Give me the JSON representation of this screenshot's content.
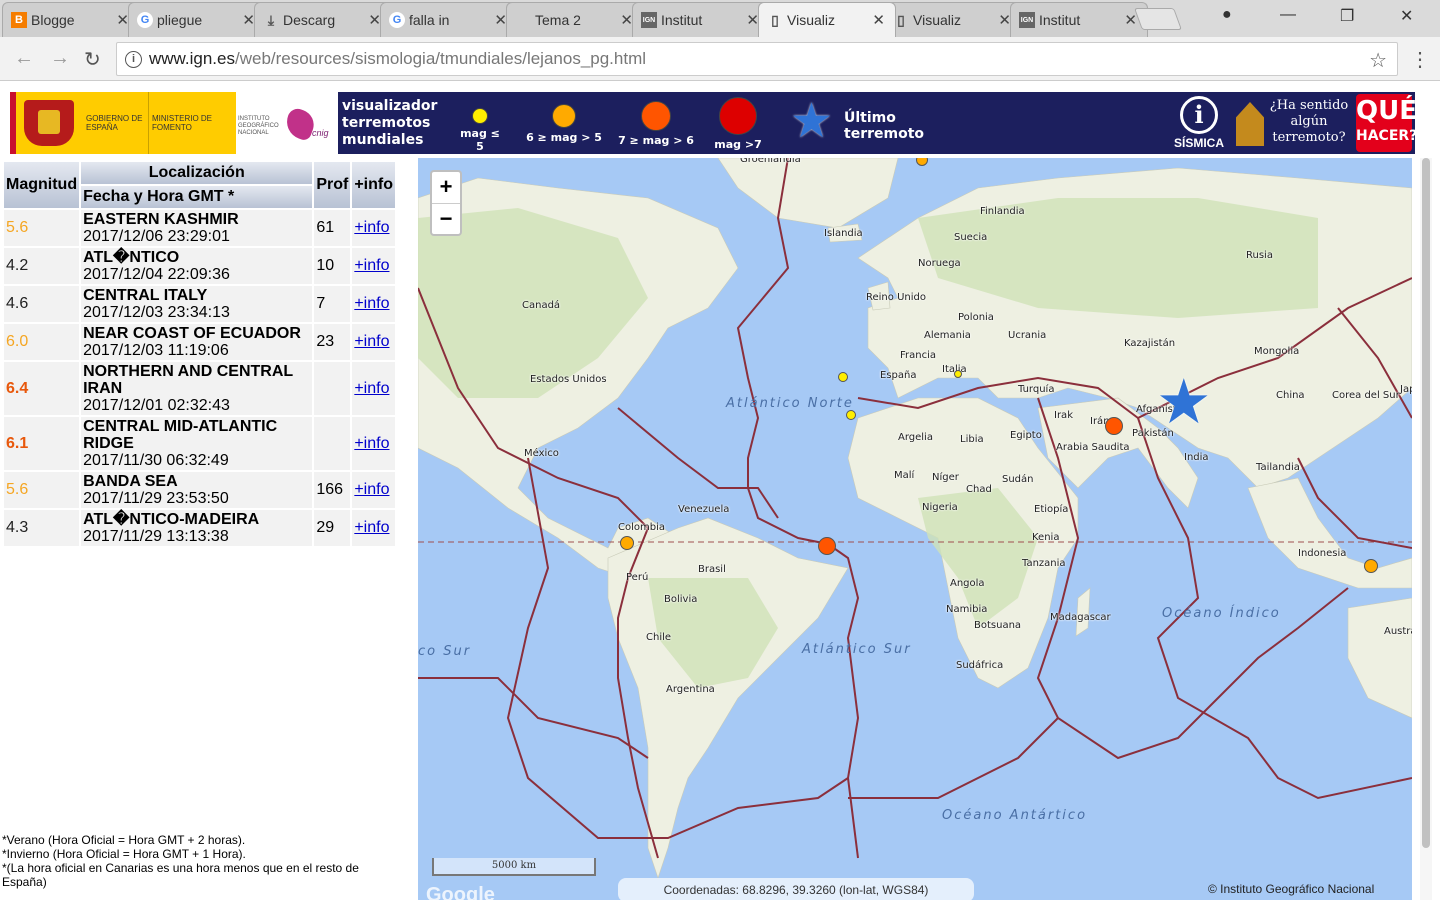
{
  "browser": {
    "tabs": [
      {
        "label": "Blogge",
        "icon": "blogger-icon",
        "color": "#f57d00",
        "glyph": "B"
      },
      {
        "label": "pliegue",
        "icon": "google-icon",
        "color": "#4285f4",
        "glyph": "G"
      },
      {
        "label": "Descarg",
        "icon": "download-icon",
        "color": "#555555",
        "glyph": "⤓"
      },
      {
        "label": "falla in",
        "icon": "google-icon",
        "color": "#4285f4",
        "glyph": "G"
      },
      {
        "label": "Tema 2",
        "icon": "page-icon",
        "color": "#dddddd",
        "glyph": ""
      },
      {
        "label": "Institut",
        "icon": "ign-icon",
        "color": "#666666",
        "glyph": "IGN"
      },
      {
        "label": "Visualiz",
        "icon": "page-icon",
        "color": "#dddddd",
        "glyph": "▯"
      },
      {
        "label": "Visualiz",
        "icon": "page-icon",
        "color": "#dddddd",
        "glyph": "▯"
      },
      {
        "label": "Institut",
        "icon": "ign-icon",
        "color": "#666666",
        "glyph": "IGN"
      }
    ],
    "active_tab": 6,
    "url_host": "www.ign.es",
    "url_path": "/web/resources/sismologia/tmundiales/lejanos_pg.html"
  },
  "banner": {
    "gov_text": "GOBIERNO DE ESPAÑA",
    "ministry_text": "MINISTERIO DE FOMENTO",
    "institute_text": "INSTITUTO GEOGRÁFICO NACIONAL",
    "cnig_text": "cnig",
    "title_lines": [
      "visualizador",
      "terremotos",
      "mundiales"
    ],
    "legend": [
      {
        "label": "mag ≤ 5",
        "color": "#ffee00",
        "size": 16
      },
      {
        "label": "6 ≥ mag > 5",
        "color": "#ffaa00",
        "size": 24
      },
      {
        "label": "7 ≥ mag > 6",
        "color": "#ff5500",
        "size": 30
      },
      {
        "label": "mag >7",
        "color": "#dd0000",
        "size": 38
      }
    ],
    "ultimo_label": "Último terremoto",
    "sismica_label": "SÍSMICA",
    "sentido_label": "¿Ha sentido algún terremoto?",
    "que_label": "QUÉ",
    "hacer_label": "HACER?"
  },
  "table": {
    "headers": {
      "magnitude": "Magnitud",
      "location": "Localización",
      "datetime": "Fecha y Hora GMT *",
      "depth": "Prof",
      "more": "+info"
    },
    "rows": [
      {
        "mag": "5.6",
        "place": "EASTERN KASHMIR",
        "time": "2017/12/06 23:29:01",
        "depth": "61",
        "link": "+info",
        "mag_color": "#f5a623",
        "mag_bold": false
      },
      {
        "mag": "4.2",
        "place": "ATL�NTICO",
        "time": "2017/12/04 22:09:36",
        "depth": "10",
        "link": "+info",
        "mag_color": "#222222",
        "mag_bold": false
      },
      {
        "mag": "4.6",
        "place": "CENTRAL ITALY",
        "time": "2017/12/03 23:34:13",
        "depth": "7",
        "link": "+info",
        "mag_color": "#222222",
        "mag_bold": false
      },
      {
        "mag": "6.0",
        "place": "NEAR COAST OF ECUADOR",
        "time": "2017/12/03 11:19:06",
        "depth": "23",
        "link": "+info",
        "mag_color": "#f5a623",
        "mag_bold": false
      },
      {
        "mag": "6.4",
        "place": "NORTHERN AND CENTRAL IRAN",
        "time": "2017/12/01 02:32:43",
        "depth": "",
        "link": "+info",
        "mag_color": "#e8580c",
        "mag_bold": true
      },
      {
        "mag": "6.1",
        "place": "CENTRAL MID-ATLANTIC RIDGE",
        "time": "2017/11/30 06:32:49",
        "depth": "",
        "link": "+info",
        "mag_color": "#e8580c",
        "mag_bold": true
      },
      {
        "mag": "5.6",
        "place": "BANDA SEA",
        "time": "2017/11/29 23:53:50",
        "depth": "166",
        "link": "+info",
        "mag_color": "#f5a623",
        "mag_bold": false
      },
      {
        "mag": "4.3",
        "place": "ATL�NTICO-MADEIRA",
        "time": "2017/11/29 13:13:38",
        "depth": "29",
        "link": "+info",
        "mag_color": "#222222",
        "mag_bold": false
      }
    ]
  },
  "footnotes": [
    "*Verano (Hora Oficial = Hora GMT + 2 horas).",
    "*Invierno (Hora Oficial = Hora GMT + 1 Hora).",
    "*(La hora oficial en Canarias es una hora menos que en el resto de España)"
  ],
  "map": {
    "zoom_in": "+",
    "zoom_out": "−",
    "scale_label": "5000 km",
    "coords_label": "Coordenadas: 68.8296, 39.3260 (lon-lat, WGS84)",
    "copyright": "© Instituto Geográfico Nacional",
    "google_label": "Google",
    "labels": [
      "Groenlandia",
      "Islandia",
      "Finlandia",
      "Suecia",
      "Noruega",
      "Rusia",
      "Reino Unido",
      "Polonia",
      "Alemania",
      "Ucrania",
      "Kazajistán",
      "Mongolia",
      "Canadá",
      "Francia",
      "España",
      "Italia",
      "Turquía",
      "Afganistán",
      "Irak",
      "Irán",
      "Pakistán",
      "China",
      "Corea del Sur",
      "Jap",
      "Estados Unidos",
      "Argelia",
      "Libia",
      "Egipto",
      "Arabia Saudita",
      "India",
      "Tailandia",
      "México",
      "Malí",
      "Níger",
      "Chad",
      "Sudán",
      "Venezuela",
      "Colombia",
      "Nigeria",
      "Etiopía",
      "Kenia",
      "Indonesia",
      "Brasil",
      "Perú",
      "Bolivia",
      "Tanzania",
      "Angola",
      "Namibia",
      "Madagascar",
      "Chile",
      "Botsuana",
      "Australia",
      "Sudáfrica",
      "Argentina"
    ],
    "oceans": [
      "Atlántico Norte",
      "Atlántico Sur",
      "Océano Índico",
      "Océano Antártico",
      "co Sur"
    ]
  }
}
